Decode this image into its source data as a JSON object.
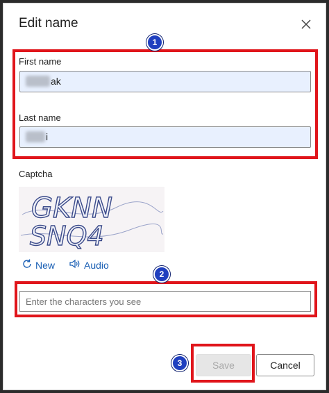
{
  "dialog": {
    "title": "Edit name",
    "close_icon": "close-icon"
  },
  "first_name": {
    "label": "First name",
    "value_visible_suffix": "ak"
  },
  "last_name": {
    "label": "Last name",
    "value_visible_suffix": "i"
  },
  "captcha": {
    "label": "Captcha",
    "image_line1": "GKNN",
    "image_line2": "SNQ4",
    "new_label": "New",
    "audio_label": "Audio",
    "input_placeholder": "Enter the characters you see"
  },
  "buttons": {
    "save_label": "Save",
    "cancel_label": "Cancel"
  },
  "annotations": {
    "badge1": "1",
    "badge2": "2",
    "badge3": "3"
  },
  "colors": {
    "highlight_red": "#e0151b",
    "badge_blue": "#1f3fbf",
    "link_blue": "#1a5fb4"
  }
}
